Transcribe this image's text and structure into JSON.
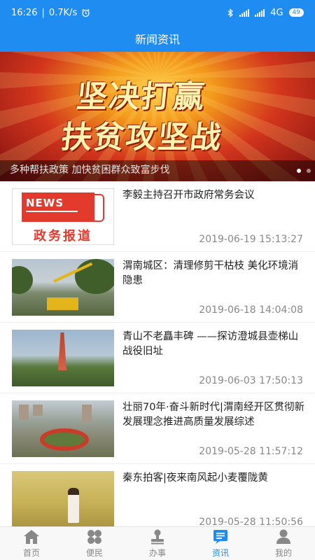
{
  "status": {
    "time": "16:26",
    "speed": "0.7K/s",
    "network": "4G",
    "battery": "49",
    "icons": [
      "alarm-icon",
      "bluetooth-icon",
      "signal-icon",
      "signal-icon",
      "battery-icon"
    ]
  },
  "header": {
    "title": "新闻资讯"
  },
  "banner": {
    "caption": "多种帮扶政策 加快贫困群众致富步伐",
    "slogan_line1": "坚决打赢",
    "slogan_line2": "扶贫攻坚战",
    "active_dot": 0
  },
  "articles": [
    {
      "title": "李毅主持召开市政府常务会议",
      "date": "2019-06-19 15:13:27",
      "thumb_text": "NEWS",
      "thumb_label": "政务报道"
    },
    {
      "title": "渭南城区：清理修剪干枯枝 美化环境消隐患",
      "date": "2019-06-18 14:04:08"
    },
    {
      "title": "青山不老矗丰碑 ——探访澄城县壶梯山战役旧址",
      "date": "2019-06-03 17:50:13"
    },
    {
      "title": "壮丽70年·奋斗新时代|渭南经开区贯彻新发展理念推进高质量发展综述",
      "date": "2019-05-28 11:57:12"
    },
    {
      "title": "秦东拍客|夜来南风起小麦覆陇黄",
      "date": "2019-05-28 11:50:56"
    }
  ],
  "tabs": [
    {
      "label": "首页",
      "icon": "home-icon",
      "active": false
    },
    {
      "label": "便民",
      "icon": "grid-icon",
      "active": false
    },
    {
      "label": "办事",
      "icon": "stamp-icon",
      "active": false
    },
    {
      "label": "资讯",
      "icon": "news-icon",
      "active": true
    },
    {
      "label": "我的",
      "icon": "person-icon",
      "active": false
    }
  ],
  "colors": {
    "primary": "#1e8cf0",
    "inactive": "#888888"
  }
}
